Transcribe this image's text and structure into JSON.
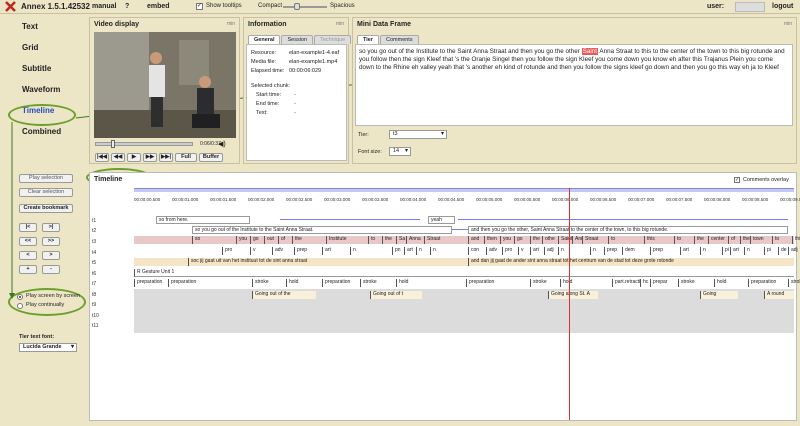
{
  "app": {
    "name": "Annex 1.5.1.42532",
    "manual": "manual",
    "help": "?",
    "embed": "embed"
  },
  "topbar": {
    "tooltips": "Show tooltips",
    "compact": "Compact",
    "spacious": "Spacious",
    "user_label": "user:",
    "logout": "logout",
    "checkbox_mark": "✓"
  },
  "nav": [
    {
      "label": "Text"
    },
    {
      "label": "Grid"
    },
    {
      "label": "Subtitle"
    },
    {
      "label": "Waveform"
    },
    {
      "label": "Timeline",
      "active": true
    },
    {
      "label": "Combined"
    }
  ],
  "left_controls": {
    "play_selection": "Play selection",
    "clear_selection": "Clear selection",
    "create_bookmark": "Create bookmark",
    "nav_buttons": [
      "|<",
      ">|",
      "<<",
      ">>",
      "<",
      ">",
      "+",
      "-"
    ],
    "play_screen": "Play screen by screen",
    "play_continually": "Play continually",
    "tier_font_label": "Tier text font:",
    "tier_font_value": "Lucida Grande"
  },
  "video": {
    "title": "Video display",
    "min": "min",
    "time": "0:06/0:37",
    "buttons": [
      "|◀◀",
      "◀◀",
      "▶",
      "▶▶",
      "▶▶|",
      "Full",
      "Buffer"
    ]
  },
  "information": {
    "title": "Information",
    "min": "min",
    "tabs": [
      "General",
      "Session",
      "Technique"
    ],
    "rows": [
      {
        "k": "Resource:",
        "v": "elan-example1-4.eaf"
      },
      {
        "k": "Media file:",
        "v": "elan-example1.mp4"
      },
      {
        "k": "Elapsed time:",
        "v": "00:00:06:029"
      }
    ],
    "selected_chunk": "Selected chunk:",
    "chunk_rows": [
      {
        "k": "Start time:",
        "v": "-"
      },
      {
        "k": "End time:",
        "v": "-"
      },
      {
        "k": "Text:",
        "v": "-"
      }
    ]
  },
  "mini": {
    "title": "Mini Data Frame",
    "min": "min",
    "tabs": [
      "Tier",
      "Comments"
    ],
    "text_before": "so you go out of the Institute to the Saint Anna Straat and then you go the other ",
    "text_hl": "Saint",
    "text_after": " Anna Straat to this to the center of the town to this big rotunde and you follow then the sign Kleef that 's the Oranje Singel then you follow the sign Kleef you come down you know eh after this Trajanus Plein you come down to the Rhine eh valley yeah that 's another eh kind of rotunde and then you follow the signs kleef go down and then you go this way eh ja to Kleef",
    "tier_label": "Tier:",
    "tier_value": "t3",
    "font_label": "Font size:",
    "font_value": "14"
  },
  "timeline": {
    "title": "Timeline",
    "comments_overlay": "Comments overlay",
    "ruler": [
      "00:00:00.500",
      "00:00:01.000",
      "00:00:01.500",
      "00:00:02.000",
      "00:00:02.500",
      "00:00:03.000",
      "00:00:03.500",
      "00:00:04.000",
      "00:00:04.500",
      "00:00:05.000",
      "00:00:05.500",
      "00:00:06.000",
      "00:00:06.500",
      "00:00:07.000",
      "00:00:07.500",
      "00:00:08.000",
      "00:00:08.500",
      "00:00:09.000"
    ],
    "tiers": [
      "t1",
      "t2",
      "t3",
      "t4",
      "t5",
      "t6",
      "t7",
      "t8",
      "t9",
      "t10",
      "t11"
    ],
    "ann_t1a": "so from here.",
    "ann_t1b": "yeah",
    "ann_t3a": "so you go out of the Institute to the Saint Anna Straat.",
    "ann_t3b": "and then you go the other, Saint Anna Straat to the center of the town, to this big rotunde.",
    "t4a_words": [
      "so",
      "you",
      "go",
      "out",
      "of",
      "the",
      "Institute",
      "to",
      "the",
      "Sa",
      "Anna",
      "Straat"
    ],
    "t4b_words": [
      "and",
      "then",
      "you",
      "go",
      "the",
      "othe",
      "Saint",
      "Anr",
      "Straat",
      "to",
      "this",
      "to",
      "the",
      "center",
      "of",
      "the",
      "town",
      "to",
      "this"
    ],
    "t5a_words": [
      "pro",
      "v",
      "adv",
      "prep",
      "art",
      "n",
      "pn",
      "art",
      "n",
      "n"
    ],
    "t5b_words": [
      "con",
      "adv",
      "pro",
      "v",
      "art",
      "adj",
      "n",
      "n",
      "prep",
      "dem",
      "prep",
      "art",
      "n",
      "pi",
      "art",
      "n",
      "pi",
      "de",
      "adj"
    ],
    "t6a": "soc jij gaat uit van het instituut tot de sint anna straat",
    "t6b": "and dan jij gaat de ander sint anna straat tot het centrum van de stad tot deze grote rotonde",
    "t7": "R Gesture Unit 1",
    "t8": [
      "preparation",
      "preparation",
      "stroke",
      "hold",
      "preparation",
      "stroke",
      "hold",
      "preparation",
      "stroke",
      "hold",
      "part.retraction",
      "hc",
      "prepar",
      "stroke",
      "hold",
      "preparation",
      "stroke"
    ],
    "t9": [
      "Going out of the",
      "Going out of t",
      "Going along St. A",
      "Going",
      "A round"
    ]
  }
}
